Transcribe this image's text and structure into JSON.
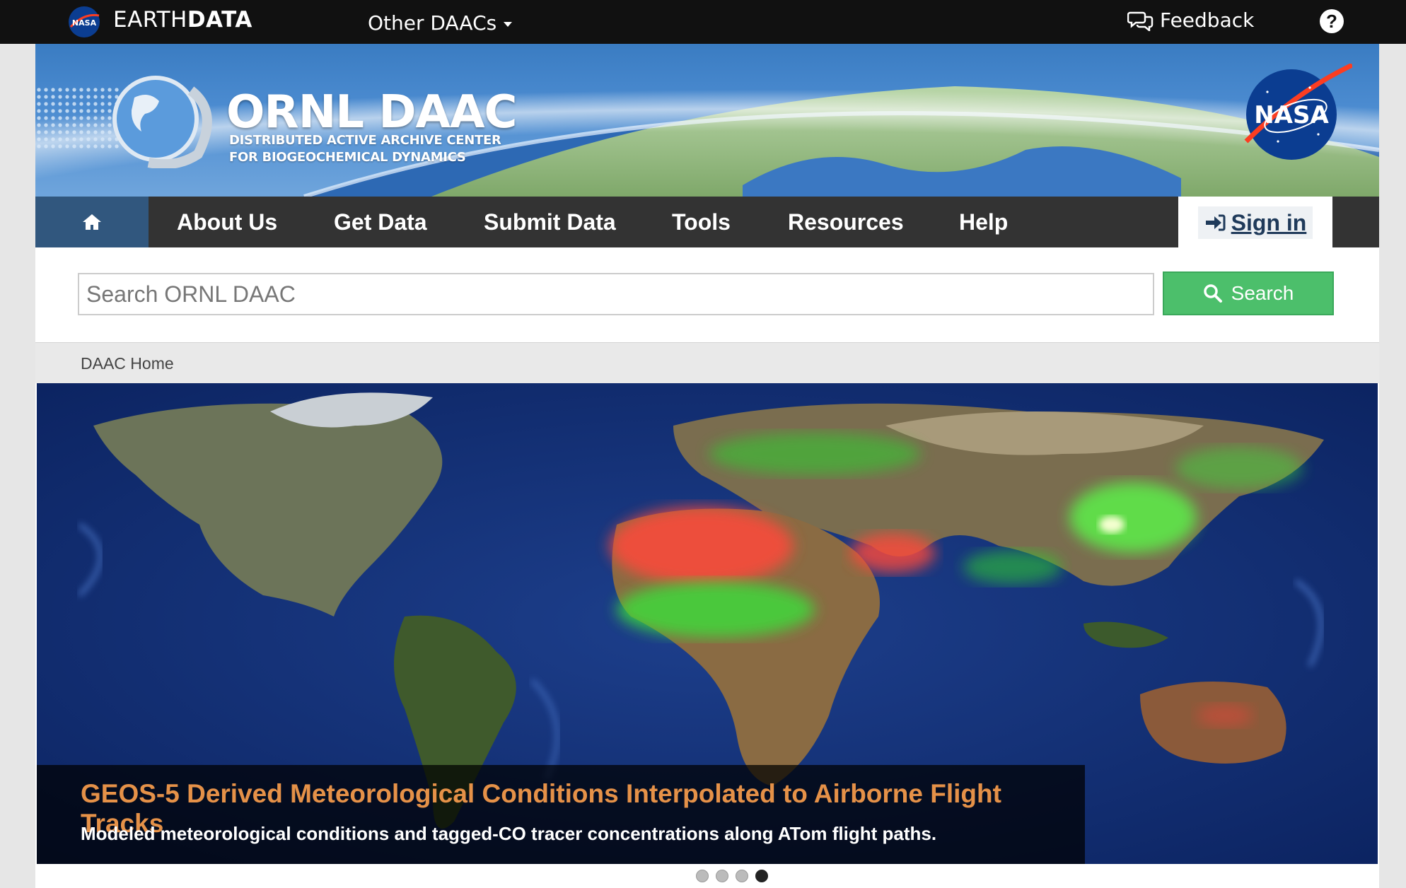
{
  "topbar": {
    "brand_light": "EARTH",
    "brand_bold": "DATA",
    "other_daacs": "Other DAACs",
    "feedback": "Feedback",
    "help": "?"
  },
  "banner": {
    "title": "ORNL DAAC",
    "subtitle_line1": "DISTRIBUTED ACTIVE ARCHIVE CENTER",
    "subtitle_line2": "FOR BIOGEOCHEMICAL DYNAMICS",
    "nasa_logo_text": "NASA"
  },
  "nav": {
    "items": [
      {
        "label": "About Us"
      },
      {
        "label": "Get Data"
      },
      {
        "label": "Submit Data"
      },
      {
        "label": "Tools"
      },
      {
        "label": "Resources"
      },
      {
        "label": "Help"
      }
    ],
    "sign_in": "Sign in"
  },
  "search": {
    "placeholder": "Search ORNL DAAC",
    "button": "Search"
  },
  "breadcrumb": {
    "home": "DAAC Home"
  },
  "carousel": {
    "title": "GEOS-5 Derived Meteorological Conditions Interpolated to Airborne Flight Tracks",
    "description": "Modeled meteorological conditions and tagged-CO tracer concentrations along ATom flight paths.",
    "slide_count": 4,
    "active_slide": 4
  },
  "colors": {
    "nav_bg": "#333333",
    "home_bg": "#31577e",
    "search_green": "#4cbf6b",
    "caption_title": "#e59148"
  }
}
